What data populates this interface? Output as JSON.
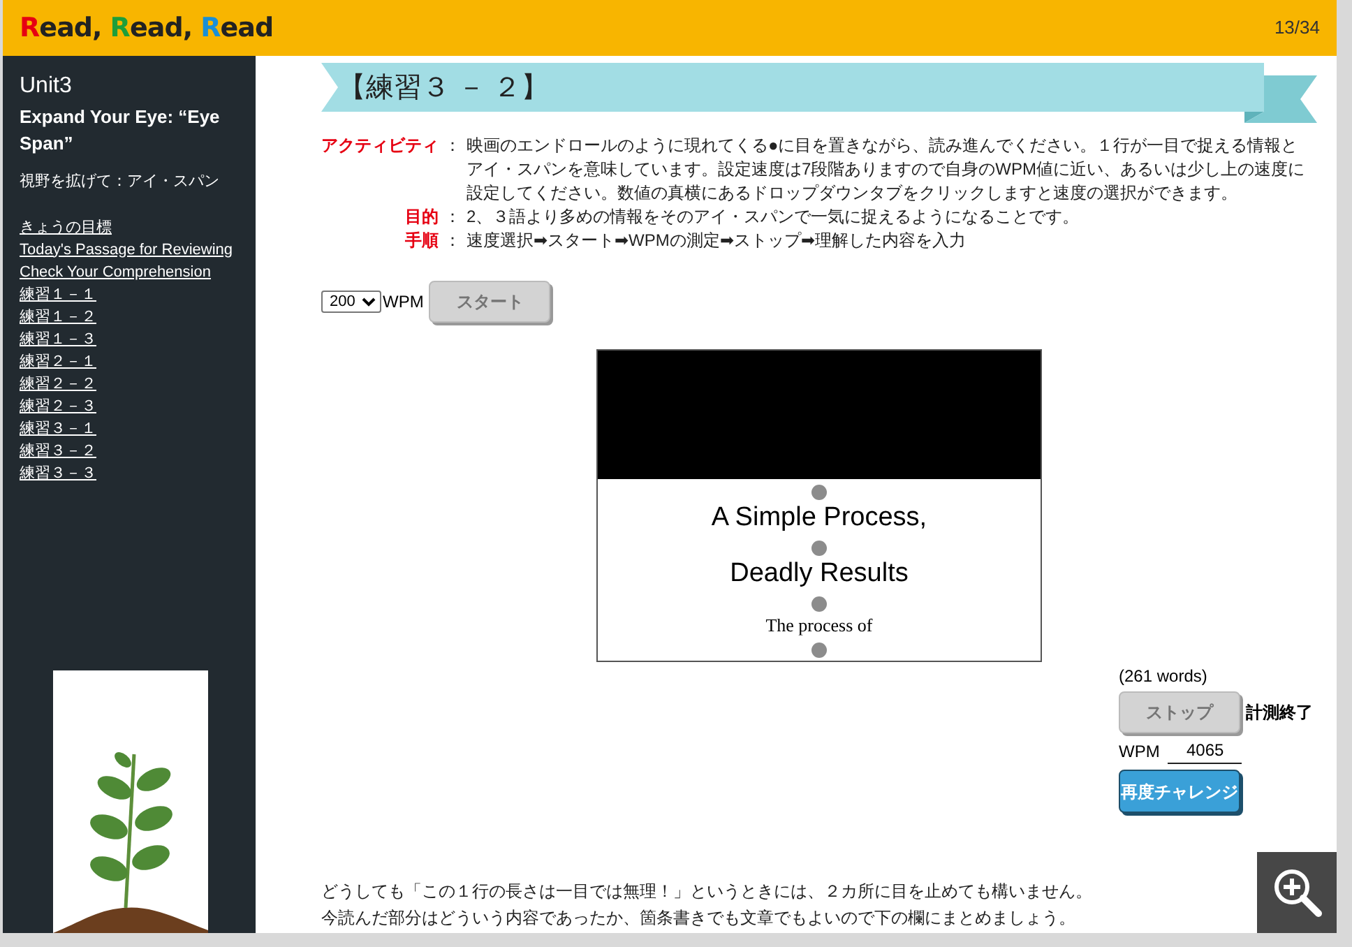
{
  "header": {
    "logo": [
      {
        "initial": "R",
        "rest": "ead,",
        "color": "#e60012"
      },
      {
        "initial": "R",
        "rest": "ead,",
        "color": "#1e9e3a"
      },
      {
        "initial": "R",
        "rest": "ead",
        "color": "#1a8fd6"
      }
    ],
    "page_counter": "13/34"
  },
  "sidebar": {
    "unit": "Unit3",
    "title": "Expand Your Eye: “Eye Span”",
    "subtitle": "視野を拡げて：アイ・スパン",
    "links": [
      "きょうの目標",
      "Today's Passage for Reviewing",
      "Check Your Comprehension",
      "練習１－１",
      "練習１－２",
      "練習１－３",
      "練習２－１",
      "練習２－２",
      "練習２－３",
      "練習３－１",
      "練習３－２",
      "練習３－３"
    ]
  },
  "banner": {
    "title": "【練習３ － ２】"
  },
  "instructions": [
    {
      "label": "アクティビティ",
      "separator": "：",
      "text": "映画のエンドロールのように現れてくる●に目を置きながら、読み進んでください。１行が一目で捉える情報とアイ・スパンを意味しています。設定速度は7段階ありますので自身のWPM値に近い、あるいは少し上の速度に設定してください。数値の真横にあるドロップダウンタブをクリックしますと速度の選択ができます。"
    },
    {
      "label": "目的",
      "separator": "：",
      "text": "2、３語より多めの情報をそのアイ・スパンで一気に捉えるようになることです。"
    },
    {
      "label": "手順",
      "separator": "：",
      "text": "速度選択➡スタート➡WPMの測定➡ストップ➡理解した内容を入力"
    }
  ],
  "controls": {
    "speed": "200",
    "speed_unit": "WPM",
    "start_button": {
      "label": "スタート",
      "disabled": true
    }
  },
  "reader": {
    "lines": [
      "A Simple Process,",
      "Deadly Results",
      "The process of"
    ]
  },
  "results": {
    "word_count": "(261 words)",
    "stop_button": {
      "label": "ストップ",
      "disabled": true
    },
    "status": "計測終了",
    "wpm_label": "WPM",
    "wpm_value": "4065",
    "retry_button": {
      "label": "再度チャレンジ",
      "disabled": false
    }
  },
  "notes": [
    "どうしても「この１行の長さは一目では無理！」というときには、２カ所に目を止めても構いません。",
    "今読んだ部分はどういう内容であったか、箇条書きでも文章でもよいので下の欄にまとめましょう。"
  ]
}
